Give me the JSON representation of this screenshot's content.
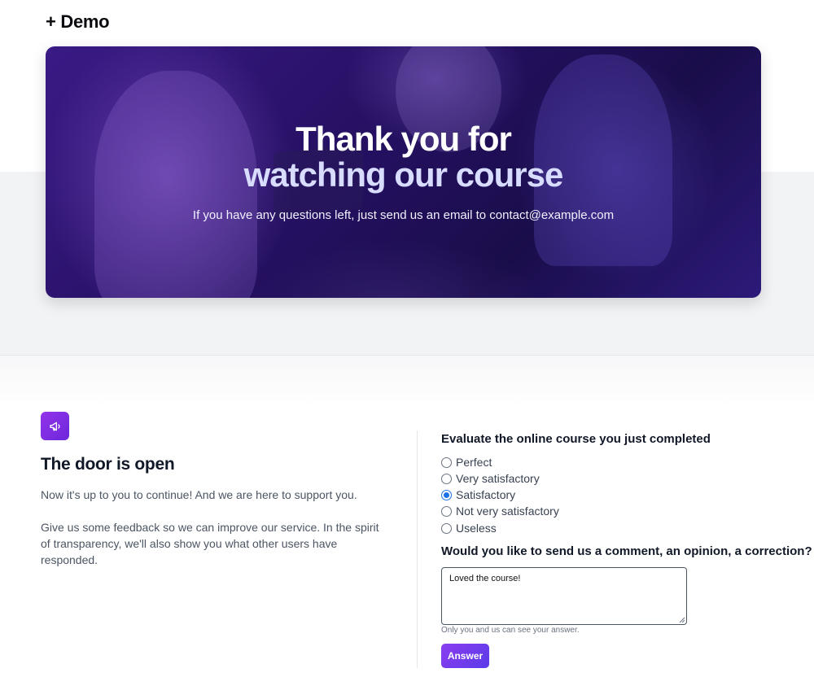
{
  "header": {
    "logo_text": "+ Demo"
  },
  "hero": {
    "title_line1": "Thank you for",
    "title_line2": "watching our course",
    "subtitle": "If you have any questions left, just send us an email to contact@example.com"
  },
  "info": {
    "icon": "megaphone-icon",
    "title": "The door is open",
    "paragraph1": "Now it's up to you to continue! And we are here to support you.",
    "paragraph2": "Give us some feedback so we can improve our service. In the spirit of transparency, we'll also show you what other users have responded."
  },
  "survey": {
    "question": "Evaluate the online course you just completed",
    "options": [
      {
        "label": "Perfect",
        "checked": false
      },
      {
        "label": "Very satisfactory",
        "checked": false
      },
      {
        "label": "Satisfactory",
        "checked": true
      },
      {
        "label": "Not very satisfactory",
        "checked": false
      },
      {
        "label": "Useless",
        "checked": false
      }
    ],
    "comment_question": "Would you like to send us a comment, an opinion, a correction?",
    "comment_value": "Loved the course!",
    "privacy_hint": "Only you and us can see your answer.",
    "submit_label": "Answer"
  },
  "colors": {
    "accent": "#7c3aed",
    "radio_checked": "#1a73e8"
  }
}
